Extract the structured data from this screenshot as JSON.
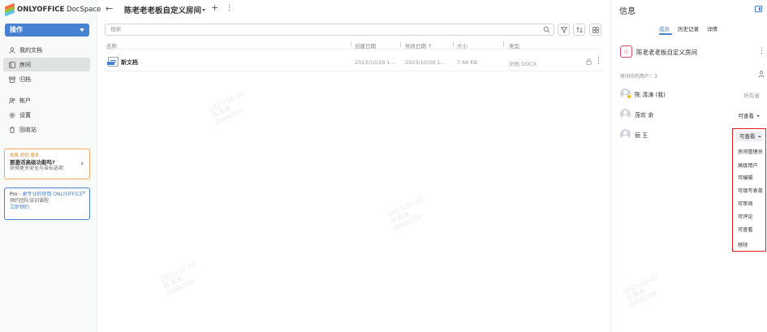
{
  "app": {
    "logo_bold": "ONLYOFFICE",
    "logo_rest": " DocSpace"
  },
  "sidebar": {
    "actions_label": "操作",
    "items": [
      {
        "label": "我的文档",
        "icon": "person-icon"
      },
      {
        "label": "房间",
        "icon": "rooms-icon",
        "active": true
      },
      {
        "label": "归档",
        "icon": "archive-icon"
      },
      {
        "label": "帐户",
        "icon": "accounts-icon"
      },
      {
        "label": "设置",
        "icon": "gear-icon"
      },
      {
        "label": "回收站",
        "icon": "trash-icon"
      }
    ],
    "promo_orange": {
      "tag": "免费 初创 版本",
      "title": "要激活高级功能吗?",
      "subtitle": "获得更多安全与自标选项"
    },
    "promo_blue": {
      "line1_prefix": "Pro - ",
      "line1_link": "更专业的使用 ONLYOFFICE",
      "line2": "预约团队培训课程",
      "link": "立即预约",
      "close": "×"
    }
  },
  "header": {
    "back_icon": "arrow-left-icon",
    "room_title": "陈老老老板自定义房间"
  },
  "search": {
    "placeholder": "搜索"
  },
  "table": {
    "columns": [
      "名称",
      "创建日期",
      "修改日期 ↑",
      "大小",
      "类型"
    ],
    "rows": [
      {
        "name": "新文档",
        "created": "2023/10/20 1...",
        "modified": "2023/10/20 1...",
        "size": "7.66 KB",
        "type": "文档 DOCX"
      }
    ]
  },
  "info": {
    "title": "信息",
    "tabs": [
      "成员",
      "历史记录",
      "详情"
    ],
    "room_name": "陈老老老板自定义房间",
    "users_count": "房间中的用户：3",
    "members": [
      {
        "name": "陈 清涛 (我)",
        "role": "所有者"
      },
      {
        "name": "茂欢 余",
        "role": "可查看"
      },
      {
        "name": "丽 王",
        "role": "可查看"
      }
    ],
    "role_options": [
      "房间管理员",
      "高级用户",
      "可编辑",
      "可填写表单",
      "可审阅",
      "可评论",
      "可查看",
      "移除"
    ]
  },
  "watermark": {
    "date": "2023-10-20",
    "name": "陈清涛",
    "code": "QIANZEH"
  },
  "colors": {
    "accent": "#4781d1",
    "highlight": "#e02020",
    "room_icon": "#e04b6a"
  }
}
